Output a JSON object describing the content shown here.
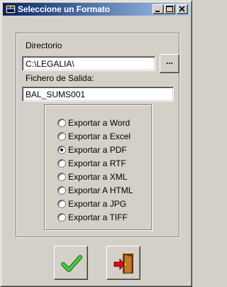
{
  "window": {
    "title": "Seleccione un Formato",
    "controls": {
      "minimize": "minimize-icon",
      "maximize": "maximize-icon",
      "close": "close-icon"
    }
  },
  "form": {
    "directorio_label": "Directorio",
    "directorio_value": "C:\\LEGALIA\\",
    "browse_label": "...",
    "fichero_label": "Fichero de Salida:",
    "fichero_value": "BAL_SUMS001"
  },
  "export_options": {
    "selected": "Exportar a PDF",
    "items": [
      "Exportar a Word",
      "Exportar a Excel",
      "Exportar a PDF",
      "Exportar a RTF",
      "Exportar a XML",
      "Exportar A HTML",
      "Exportar a JPG",
      "Exportar a TIFF"
    ]
  },
  "actions": {
    "accept_icon": "check-icon",
    "exit_icon": "exit-door-icon"
  },
  "colors": {
    "face": "#d4d0c8",
    "title_start": "#0a246a",
    "title_end": "#a6caf0",
    "check_green": "#2fb52f",
    "door_brown": "#b5651d",
    "arrow_red": "#d01010"
  }
}
